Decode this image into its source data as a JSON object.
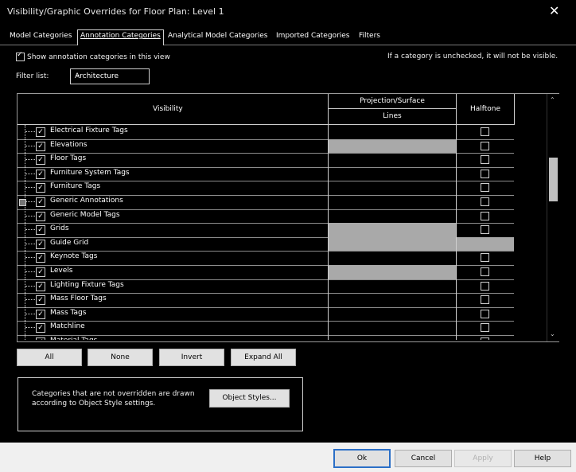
{
  "window": {
    "title": "Visibility/Graphic Overrides for Floor Plan: Level 1",
    "close_glyph": "✕"
  },
  "tabs": [
    {
      "label": "Model Categories",
      "active": false
    },
    {
      "label": "Annotation Categories",
      "active": true
    },
    {
      "label": "Analytical Model Categories",
      "active": false
    },
    {
      "label": "Imported Categories",
      "active": false
    },
    {
      "label": "Filters",
      "active": false
    }
  ],
  "show_annotations": {
    "label": "Show annotation categories in this view",
    "checked": true
  },
  "hint": "If a category is unchecked, it will not be visible.",
  "filter": {
    "label": "Filter list:",
    "value": "Architecture",
    "arrow": "⌄"
  },
  "grid": {
    "headers": {
      "visibility": "Visibility",
      "projection_surface": "Projection/Surface",
      "lines": "Lines",
      "halftone": "Halftone"
    },
    "rows": [
      {
        "name": "Electrical Fixture Tags",
        "checked": true,
        "expander": false,
        "lines_disabled": false,
        "halftone_disabled": false
      },
      {
        "name": "Elevations",
        "checked": true,
        "expander": false,
        "lines_disabled": true,
        "halftone_disabled": false
      },
      {
        "name": "Floor Tags",
        "checked": true,
        "expander": false,
        "lines_disabled": false,
        "halftone_disabled": false
      },
      {
        "name": "Furniture System Tags",
        "checked": true,
        "expander": false,
        "lines_disabled": false,
        "halftone_disabled": false
      },
      {
        "name": "Furniture Tags",
        "checked": true,
        "expander": false,
        "lines_disabled": false,
        "halftone_disabled": false
      },
      {
        "name": "Generic Annotations",
        "checked": true,
        "expander": true,
        "lines_disabled": false,
        "halftone_disabled": false
      },
      {
        "name": "Generic Model Tags",
        "checked": true,
        "expander": false,
        "lines_disabled": false,
        "halftone_disabled": false
      },
      {
        "name": "Grids",
        "checked": true,
        "expander": false,
        "lines_disabled": true,
        "halftone_disabled": false
      },
      {
        "name": "Guide Grid",
        "checked": true,
        "expander": false,
        "lines_disabled": true,
        "halftone_disabled": true
      },
      {
        "name": "Keynote Tags",
        "checked": true,
        "expander": false,
        "lines_disabled": false,
        "halftone_disabled": false
      },
      {
        "name": "Levels",
        "checked": true,
        "expander": false,
        "lines_disabled": true,
        "halftone_disabled": false
      },
      {
        "name": "Lighting Fixture Tags",
        "checked": true,
        "expander": false,
        "lines_disabled": false,
        "halftone_disabled": false
      },
      {
        "name": "Mass Floor Tags",
        "checked": true,
        "expander": false,
        "lines_disabled": false,
        "halftone_disabled": false
      },
      {
        "name": "Mass Tags",
        "checked": true,
        "expander": false,
        "lines_disabled": false,
        "halftone_disabled": false
      },
      {
        "name": "Matchline",
        "checked": true,
        "expander": false,
        "lines_disabled": false,
        "halftone_disabled": false
      },
      {
        "name": "Material Tags",
        "checked": true,
        "expander": false,
        "lines_disabled": false,
        "halftone_disabled": false
      }
    ],
    "scroll": {
      "up": "⌃",
      "down": "⌄"
    }
  },
  "actions": {
    "all": "All",
    "none": "None",
    "invert": "Invert",
    "expand_all": "Expand All"
  },
  "panel": {
    "text": "Categories that are not overridden are drawn according to Object Style settings.",
    "object_styles": "Object Styles..."
  },
  "footer": {
    "ok": "Ok",
    "cancel": "Cancel",
    "apply": "Apply",
    "help": "Help"
  },
  "colors": {
    "disabled_cell": "#a9a9a9",
    "ok_border": "#2b6fc7"
  }
}
